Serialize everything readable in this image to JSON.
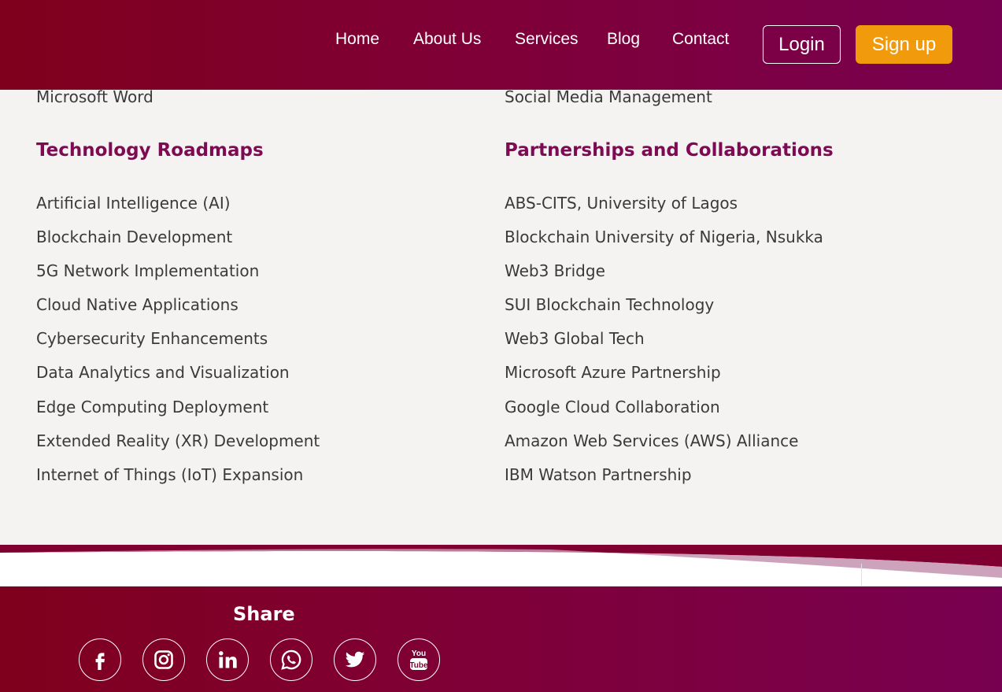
{
  "nav": {
    "links": [
      "Home",
      "About Us",
      "Services",
      "Blog",
      "Contact"
    ],
    "login_label": "Login",
    "signup_label": "Sign up"
  },
  "left": {
    "cut_item": "Microsoft Word",
    "heading": "Technology Roadmaps",
    "items": [
      "Artificial Intelligence (AI)",
      "Blockchain Development",
      "5G Network Implementation",
      "Cloud Native Applications",
      "Cybersecurity Enhancements",
      "Data Analytics and Visualization",
      "Edge Computing Deployment",
      "Extended Reality (XR) Development",
      "Internet of Things (IoT) Expansion"
    ]
  },
  "right": {
    "cut_item": "Social Media Management",
    "heading": "Partnerships and Collaborations",
    "items": [
      "ABS-CITS, University of Lagos",
      "Blockchain University of Nigeria, Nsukka",
      "Web3 Bridge",
      "SUI Blockchain Technology",
      "Web3 Global Tech",
      "Microsoft Azure Partnership",
      "Google Cloud Collaboration",
      "Amazon Web Services (AWS) Alliance",
      "IBM Watson Partnership"
    ]
  },
  "footer": {
    "share_title": "Share",
    "social_icons": [
      "facebook-icon",
      "instagram-icon",
      "linkedin-icon",
      "whatsapp-icon",
      "twitter-icon",
      "youtube-icon"
    ],
    "youtube_text_top": "You",
    "youtube_text_bottom": "Tube"
  },
  "colors": {
    "brand_maroon": "#7f001c",
    "brand_purple": "#780050",
    "heading": "#7d0a52",
    "accent_orange": "#f09a0c",
    "page_bg": "#f4f3f2"
  }
}
